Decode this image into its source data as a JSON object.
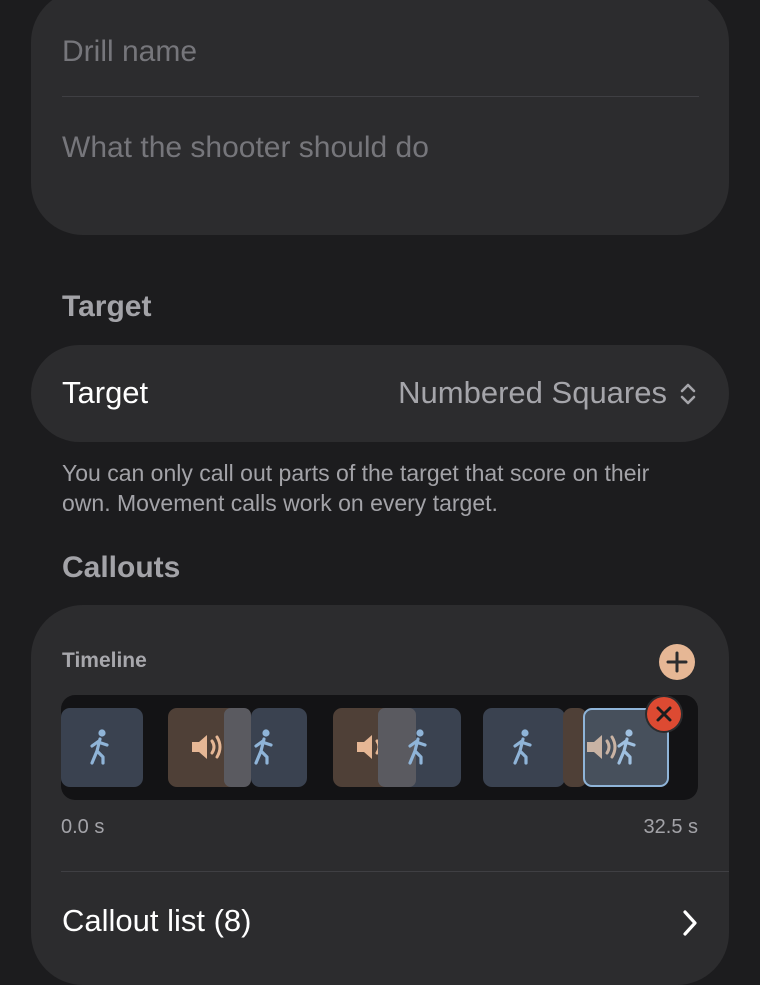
{
  "drill": {
    "name_placeholder": "Drill name",
    "description_placeholder": "What the shooter should do"
  },
  "target_section": {
    "header": "Target",
    "row_label": "Target",
    "row_value": "Numbered Squares",
    "footnote": "You can only call out parts of the target that score on their own. Movement calls work on every target."
  },
  "callouts_section": {
    "header": "Callouts",
    "timeline_label": "Timeline",
    "start_time": "0.0 s",
    "end_time": "32.5 s",
    "list_label": "Callout list (8)",
    "icons": {
      "add": "plus-circle-icon",
      "delete": "x-circle-icon",
      "movement": "figure-walk-icon",
      "voice": "speaker-wave-icon"
    }
  },
  "colors": {
    "background": "#1c1c1e",
    "card": "#2c2c2e",
    "accent_peach": "#e6b795",
    "movement_blue": "#8fb4d8",
    "delete_red": "#dd4a32"
  }
}
